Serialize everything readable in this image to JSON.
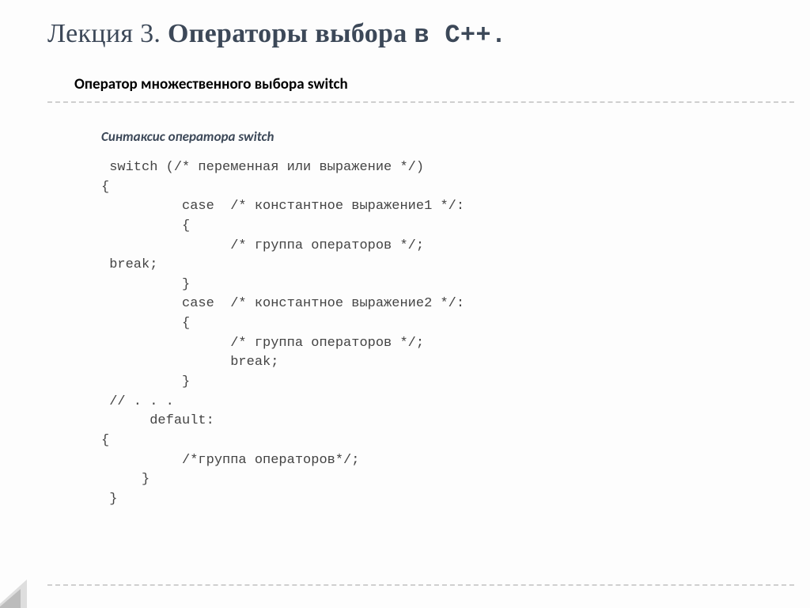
{
  "title": {
    "light": "Лекция 3. ",
    "bold": "Операторы выбора ",
    "mono": "в С++."
  },
  "subtitle": "Оператор множественного выбора switch",
  "section_heading": "Синтаксис оператора switch",
  "code": " switch (/* переменная или выражение */)\n{\n          case  /* константное выражение1 */:\n          {\n                /* группа операторов */;\n break;\n          }\n          case  /* константное выражение2 */:\n          {\n                /* группа операторов */;\n                break;\n          }\n // . . .\n      default:\n{\n          /*группа операторов*/;\n     }\n }"
}
